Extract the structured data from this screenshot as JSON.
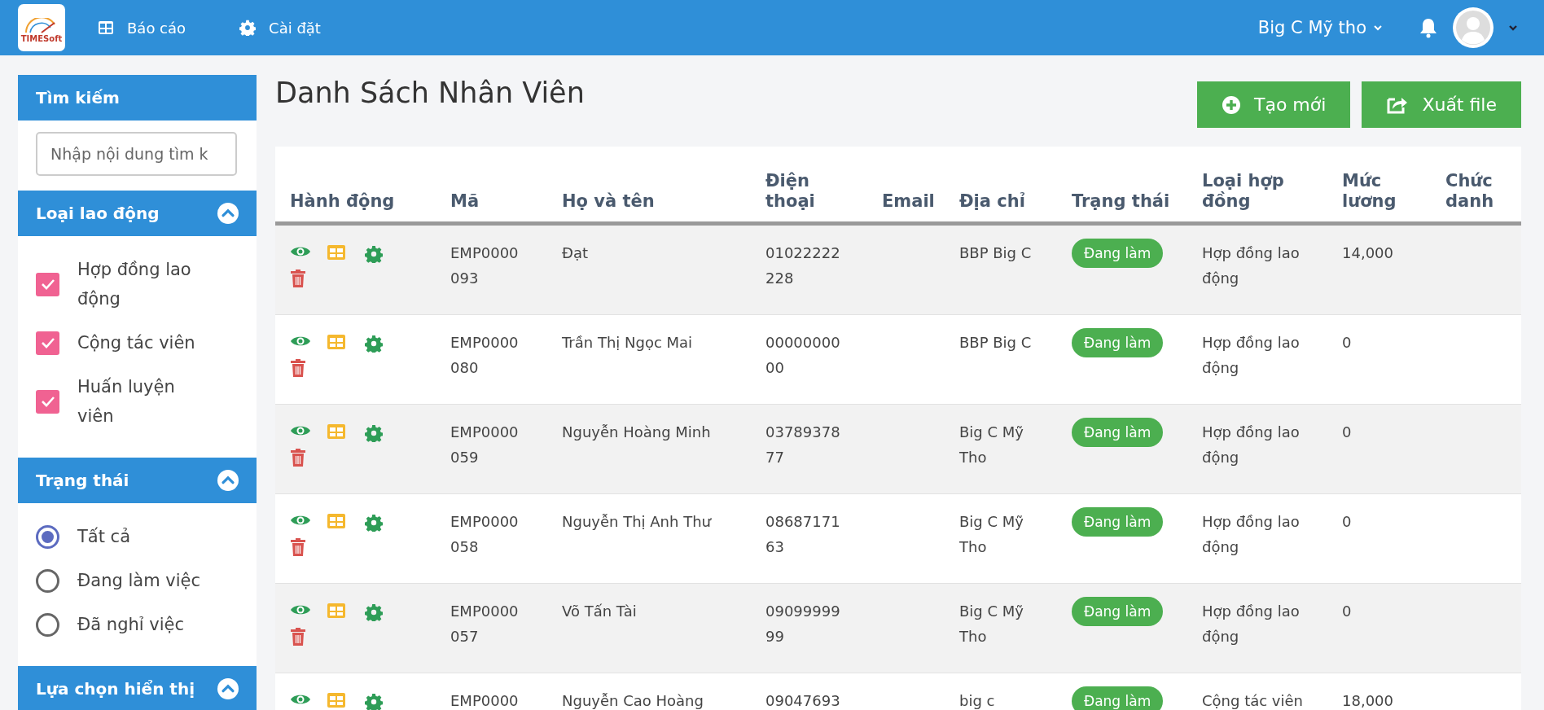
{
  "topbar": {
    "logo_text": "TIMESoft",
    "nav": [
      "Báo cáo",
      "Cài đặt"
    ],
    "location": "Big C Mỹ tho"
  },
  "sidebar": [
    {
      "kind": "search",
      "title": "Tìm kiếm",
      "placeholder": "Nhập nội dung tìm k"
    },
    {
      "kind": "checkbox",
      "title": "Loại lao động",
      "expanded": true,
      "items": [
        {
          "label": "Hợp đồng lao động",
          "checked": true
        },
        {
          "label": "Cộng tác viên",
          "checked": true
        },
        {
          "label": "Huấn luyện viên",
          "checked": true
        }
      ]
    },
    {
      "kind": "radio",
      "title": "Trạng thái",
      "expanded": true,
      "items": [
        {
          "label": "Tất cả",
          "selected": true
        },
        {
          "label": "Đang làm việc",
          "selected": false
        },
        {
          "label": "Đã nghỉ việc",
          "selected": false
        }
      ]
    },
    {
      "kind": "radio",
      "title": "Lựa chọn hiển thị",
      "expanded": true
    }
  ],
  "page_title": "Danh Sách Nhân Viên",
  "actions": [
    "Tạo mới",
    "Xuất file"
  ],
  "table": {
    "columns": [
      "Hành động",
      "Mã",
      "Họ và tên",
      "Điện thoại",
      "Email",
      "Địa chỉ",
      "Trạng thái",
      "Loại hợp đồng",
      "Mức lương",
      "Chức danh"
    ],
    "rows": [
      {
        "code": "EMP0000093",
        "name": "Đạt",
        "phone": "01022222228",
        "address": "BBP Big C",
        "status": "Đang làm",
        "contract": "Hợp đồng lao động",
        "salary": "14,000"
      },
      {
        "code": "EMP0000080",
        "name": "Trần Thị Ngọc Mai",
        "phone": "0000000000",
        "address": "BBP Big C",
        "status": "Đang làm",
        "contract": "Hợp đồng lao động",
        "salary": "0"
      },
      {
        "code": "EMP0000059",
        "name": "Nguyễn Hoàng Minh",
        "phone": "0378937877",
        "address": "Big C Mỹ Tho",
        "status": "Đang làm",
        "contract": "Hợp đồng lao động",
        "salary": "0"
      },
      {
        "code": "EMP0000058",
        "name": "Nguyễn Thị Anh Thư",
        "phone": "0868717163",
        "address": "Big C Mỹ Tho",
        "status": "Đang làm",
        "contract": "Hợp đồng lao động",
        "salary": "0"
      },
      {
        "code": "EMP0000057",
        "name": "Võ Tấn Tài",
        "phone": "0909999999",
        "address": "Big C Mỹ Tho",
        "status": "Đang làm",
        "contract": "Hợp đồng lao động",
        "salary": "0"
      },
      {
        "code": "EMP0000",
        "name": "Nguyễn Cao Hoàng",
        "phone": "09047693",
        "address": "big c",
        "status": "Đang làm",
        "contract": "Cộng tác viên",
        "salary": "18,000"
      }
    ]
  }
}
